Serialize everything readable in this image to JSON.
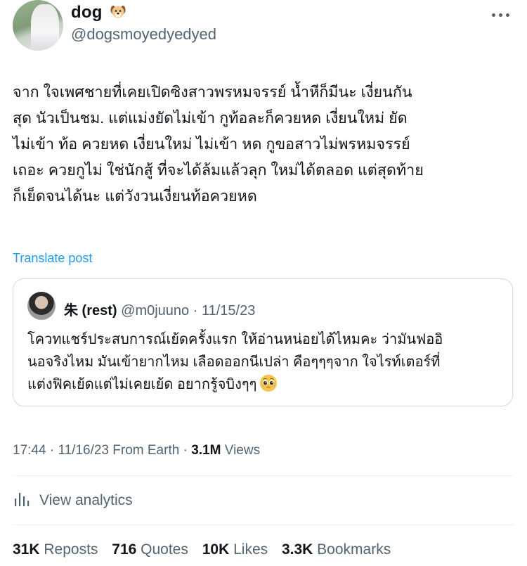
{
  "author": {
    "display_name": "dog",
    "name_emoji_icon": "dog-face-icon",
    "handle": "@dogsmoyedyedyed"
  },
  "tweet": {
    "text": "จาก ใจเพศชายที่เคยเปิดซิงสาวพรหมจรรย์ น้ำหีก็มีนะ เงี่ยนกัน\nสุด นัวเป็นชม. แต่แม่งยัดไม่เข้า กูท้อละก็ควยหด เงี่ยนใหม่ ยัด\nไม่เข้า ท้อ ควยหด เงี่ยนใหม่ ไม่เข้า หด กูขอสาวไม่พรหมจรรย์\nเถอะ ควยกูไม่ ใช่นักสู้ ที่จะได้ล้มแล้วลุก ใหม่ได้ตลอด แต่สุดท้าย\nก็เย็ดจนได้นะ แต่วังวนเงี่ยนท้อควยหด",
    "translate_label": "Translate post"
  },
  "quote": {
    "name": "朱 (rest)",
    "handle": "@m0juuno",
    "separator": "·",
    "date": "11/15/23",
    "text": "โควทแชร์ประสบการณ์เย้ดครั้งแรก ให้อ่านหน่อยได้ไหมคะ ว่ามันฟออิ\nนอจริงไหม มันเข้ายากไหม เลือดออกนีเปล่า คือๆๆๆจาก ใจไรท์เตอร์ที่\nแต่งฟิคเย้ดแต่ไม่เคยเย้ด อยากรู้จบิงๆๆ",
    "emoji_icon": "pleading-face-icon"
  },
  "meta": {
    "time": "17:44",
    "separator": "·",
    "date": "11/16/23",
    "source": "From Earth",
    "views_count": "3.1M",
    "views_label": "Views"
  },
  "analytics": {
    "label": "View analytics"
  },
  "stats": {
    "reposts_count": "31K",
    "reposts_label": "Reposts",
    "quotes_count": "716",
    "quotes_label": "Quotes",
    "likes_count": "10K",
    "likes_label": "Likes",
    "bookmarks_count": "3.3K",
    "bookmarks_label": "Bookmarks"
  },
  "colors": {
    "link": "#1d9bf0",
    "secondary_text": "#536471",
    "primary_text": "#0f1419",
    "border": "#cfd9de"
  }
}
